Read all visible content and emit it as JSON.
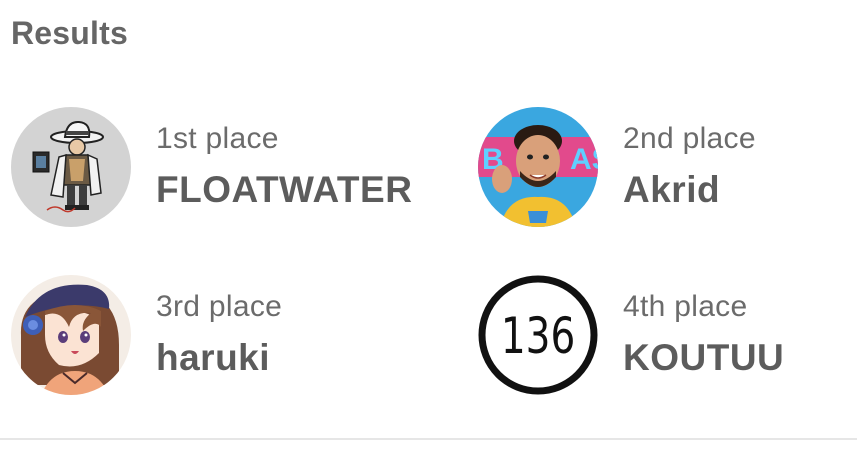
{
  "results": {
    "title": "Results",
    "entries": [
      {
        "place": "1st place",
        "name": "FLOATWATER",
        "avatar_icon": "cartoon-gunslinger-avatar-icon"
      },
      {
        "place": "2nd place",
        "name": "Akrid",
        "avatar_icon": "person-photo-avatar-icon"
      },
      {
        "place": "3rd place",
        "name": "haruki",
        "avatar_icon": "anime-girl-avatar-icon"
      },
      {
        "place": "4th place",
        "name": "KOUTUU",
        "avatar_icon": "number-136-avatar-icon",
        "avatar_text": "136"
      }
    ]
  },
  "colors": {
    "title": "#666666",
    "text": "#5c5c5c",
    "divider": "#e6e6e6"
  }
}
